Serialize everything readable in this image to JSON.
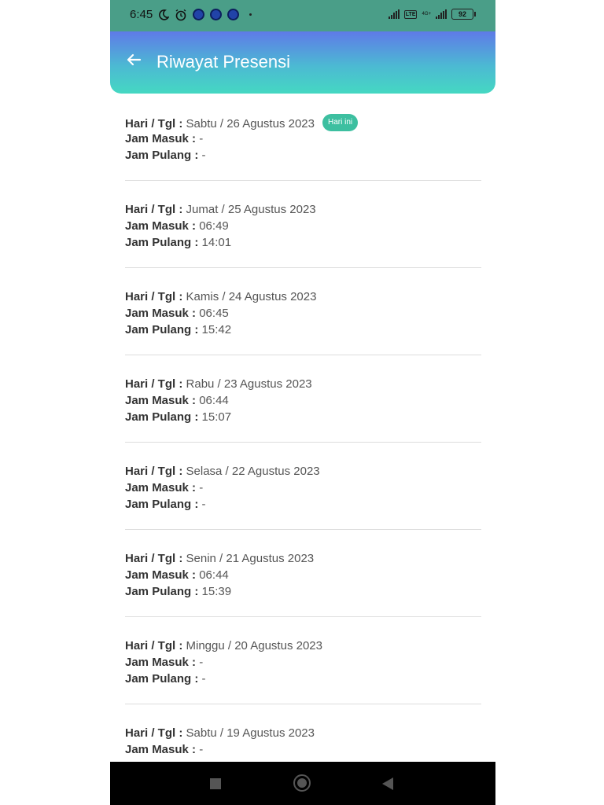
{
  "status_bar": {
    "time": "6:45",
    "battery": "92",
    "network": "4G+",
    "lte_label": "LTE"
  },
  "header": {
    "title": "Riwayat Presensi"
  },
  "labels": {
    "date": "Hari / Tgl :",
    "in": "Jam Masuk :",
    "out": "Jam Pulang :",
    "today_badge": "Hari ini"
  },
  "records": [
    {
      "date": "Sabtu / 26 Agustus 2023",
      "in": "-",
      "out": "-"
    },
    {
      "date": "Jumat / 25 Agustus 2023",
      "in": "06:49",
      "out": "14:01"
    },
    {
      "date": "Kamis / 24 Agustus 2023",
      "in": "06:45",
      "out": "15:42"
    },
    {
      "date": "Rabu / 23 Agustus 2023",
      "in": "06:44",
      "out": "15:07"
    },
    {
      "date": "Selasa / 22 Agustus 2023",
      "in": "-",
      "out": "-"
    },
    {
      "date": "Senin / 21 Agustus 2023",
      "in": "06:44",
      "out": "15:39"
    },
    {
      "date": "Minggu / 20 Agustus 2023",
      "in": "-",
      "out": "-"
    },
    {
      "date": "Sabtu / 19 Agustus 2023",
      "in": "-",
      "out": ""
    }
  ]
}
